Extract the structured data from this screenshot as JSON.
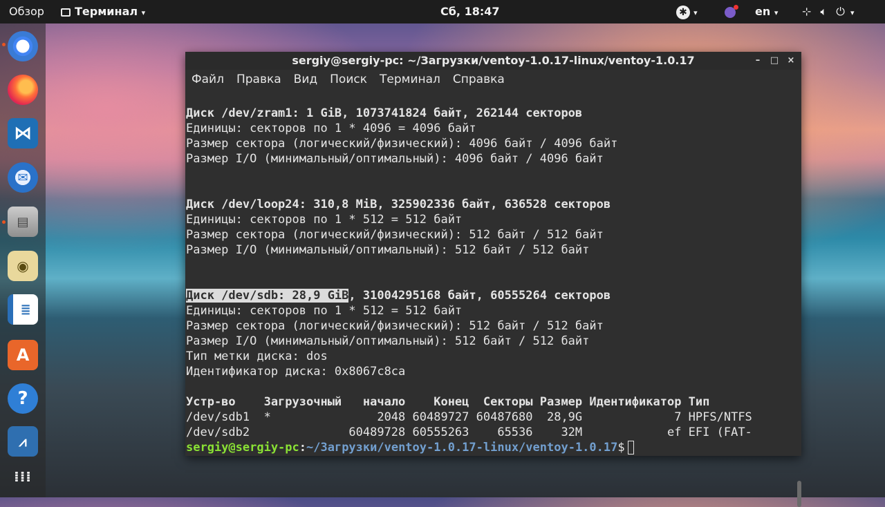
{
  "topbar": {
    "activities": "Обзор",
    "app_menu": "Терминал",
    "clock": "Сб, 18:47",
    "lang": "en"
  },
  "dock": {
    "icons": [
      "chromium-icon",
      "firefox-icon",
      "vscode-icon",
      "thunderbird-icon",
      "files-icon",
      "rhythmbox-icon",
      "writer-icon",
      "software-icon",
      "help-icon",
      "system-monitor-icon",
      "app-grid-icon"
    ]
  },
  "window": {
    "title": "sergiy@sergiy-pc: ~/Загрузки/ventoy-1.0.17-linux/ventoy-1.0.17",
    "menu": [
      "Файл",
      "Правка",
      "Вид",
      "Поиск",
      "Терминал",
      "Справка"
    ]
  },
  "terminal": {
    "l1": "Диск /dev/zram1: 1 GiB, 1073741824 байт, 262144 секторов",
    "l2": "Единицы: секторов по 1 * 4096 = 4096 байт",
    "l3": "Размер сектора (логический/физический): 4096 байт / 4096 байт",
    "l4": "Размер I/O (минимальный/оптимальный): 4096 байт / 4096 байт",
    "l5": "Диск /dev/loop24: 310,8 MiB, 325902336 байт, 636528 секторов",
    "l6": "Единицы: секторов по 1 * 512 = 512 байт",
    "l7": "Размер сектора (логический/физический): 512 байт / 512 байт",
    "l8": "Размер I/O (минимальный/оптимальный): 512 байт / 512 байт",
    "l9_hl": "Диск /dev/sdb: 28,9 GiB",
    "l9_rest": ", 31004295168 байт, 60555264 секторов",
    "l10": "Единицы: секторов по 1 * 512 = 512 байт",
    "l11": "Размер сектора (логический/физический): 512 байт / 512 байт",
    "l12": "Размер I/O (минимальный/оптимальный): 512 байт / 512 байт",
    "l13": "Тип метки диска: dos",
    "l14": "Идентификатор диска: 0x8067c8ca",
    "header": "Устр-во    Загрузочный   начало    Конец  Секторы Размер Идентификатор Тип",
    "row1": "/dev/sdb1  *               2048 60489727 60487680  28,9G             7 HPFS/NTFS",
    "row2": "/dev/sdb2              60489728 60555263    65536    32M            ef EFI (FAT-",
    "prompt_user": "sergiy@sergiy-pc",
    "prompt_path": "~/Загрузки/ventoy-1.0.17-linux/ventoy-1.0.17",
    "prompt_sign": "$"
  }
}
